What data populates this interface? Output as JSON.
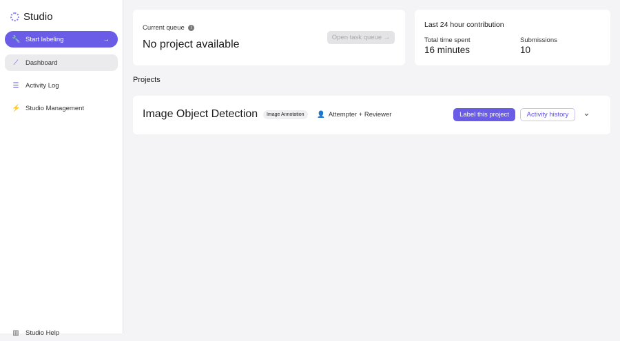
{
  "app": {
    "title": "Studio"
  },
  "sidebar": {
    "start": "Start labeling",
    "items": [
      {
        "label": "Dashboard"
      },
      {
        "label": "Activity Log"
      },
      {
        "label": "Studio Management"
      }
    ],
    "help": "Studio Help"
  },
  "queue": {
    "label": "Current queue",
    "value": "No project available",
    "button": "Open task queue"
  },
  "contrib": {
    "title": "Last 24 hour contribution",
    "time_label": "Total time spent",
    "time_value": "16 minutes",
    "sub_label": "Submissions",
    "sub_value": "10"
  },
  "projects": {
    "heading": "Projects",
    "items": [
      {
        "name": "Image Object Detection",
        "tag": "Image Annotation",
        "role": "Attempter + Reviewer",
        "label_btn": "Label this project",
        "history_btn": "Activity history"
      }
    ]
  }
}
